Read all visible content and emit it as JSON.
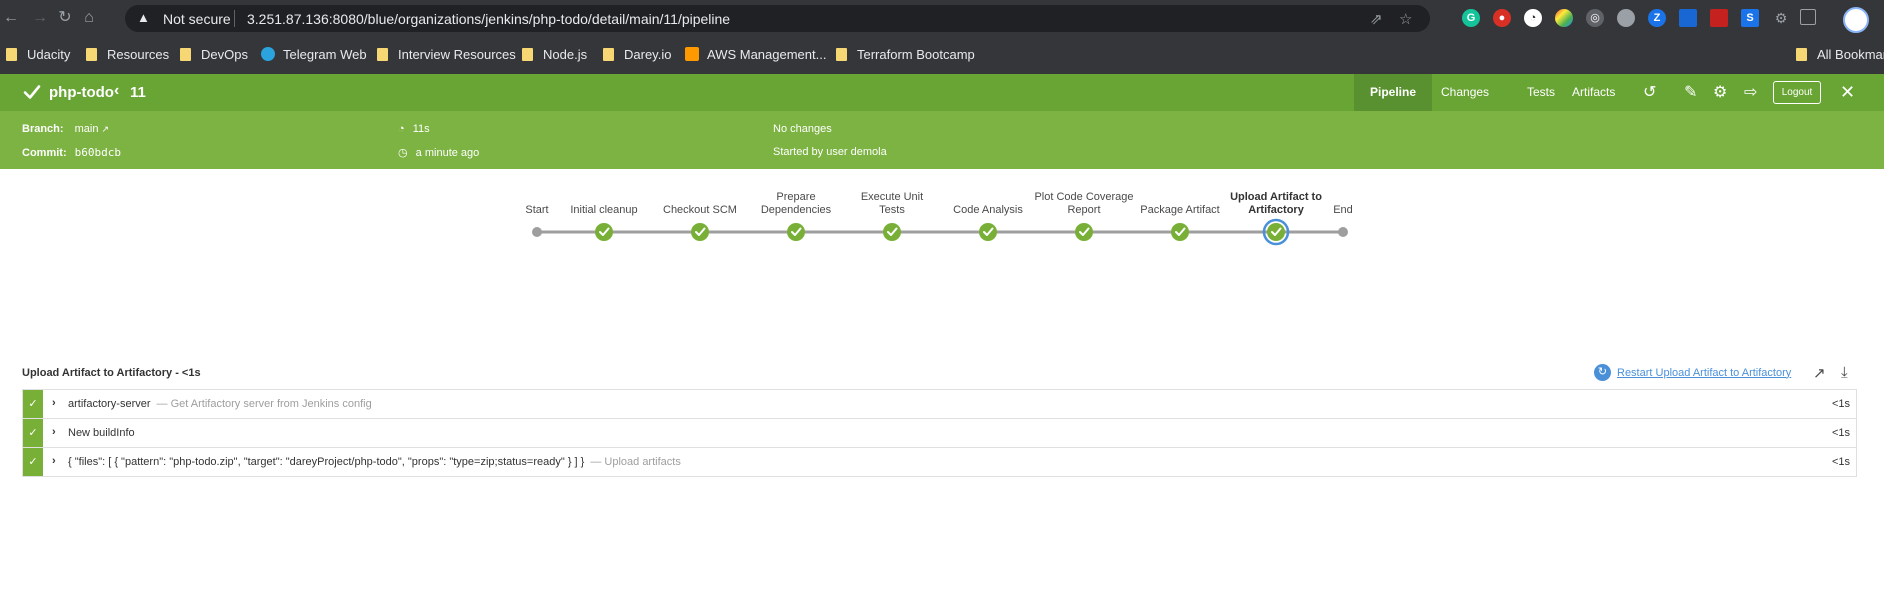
{
  "browser": {
    "security_label": "Not secure",
    "url": "3.251.87.136:8080/blue/organizations/jenkins/php-todo/detail/main/11/pipeline",
    "bookmarks": [
      {
        "label": "Udacity",
        "icon": "folder-icon"
      },
      {
        "label": "Resources",
        "icon": "folder-icon"
      },
      {
        "label": "DevOps",
        "icon": "folder-icon"
      },
      {
        "label": "Telegram Web",
        "icon": "telegram-icon"
      },
      {
        "label": "Interview Resources",
        "icon": "folder-icon"
      },
      {
        "label": "Node.js",
        "icon": "folder-icon"
      },
      {
        "label": "Darey.io",
        "icon": "folder-icon"
      },
      {
        "label": "AWS Management...",
        "icon": "aws-icon"
      },
      {
        "label": "Terraform Bootcamp",
        "icon": "folder-icon"
      }
    ],
    "all_bookmarks": "All Bookmar"
  },
  "header": {
    "project": "php-todo",
    "run_number": "11",
    "tabs": [
      "Pipeline",
      "Changes",
      "Tests",
      "Artifacts"
    ],
    "active_tab": "Pipeline",
    "logout_label": "Logout",
    "accent_color": "#69a535"
  },
  "meta": {
    "branch_label": "Branch:",
    "branch_value": "main",
    "commit_label": "Commit:",
    "commit_value": "b60bdcb",
    "duration": "11s",
    "time_ago": "a minute ago",
    "changes": "No changes",
    "started_by": "Started by user demola"
  },
  "pipeline": {
    "stages": [
      {
        "label": "Start",
        "status": "start"
      },
      {
        "label": "Initial cleanup",
        "status": "success"
      },
      {
        "label": "Checkout SCM",
        "status": "success"
      },
      {
        "label": "Prepare Dependencies",
        "status": "success"
      },
      {
        "label": "Execute Unit Tests",
        "status": "success"
      },
      {
        "label": "Code Analysis",
        "status": "success"
      },
      {
        "label": "Plot Code Coverage Report",
        "status": "success"
      },
      {
        "label": "Package Artifact",
        "status": "success"
      },
      {
        "label": "Upload Artifact to Artifactory",
        "status": "success",
        "selected": true
      },
      {
        "label": "End",
        "status": "end"
      }
    ]
  },
  "details": {
    "title": "Upload Artifact to Artifactory - <1s",
    "restart_label": "Restart Upload Artifact to Artifactory",
    "steps": [
      {
        "text": "artifactory-server",
        "desc": "— Get Artifactory server from Jenkins config",
        "duration": "<1s"
      },
      {
        "text": "New buildInfo",
        "desc": "",
        "duration": "<1s"
      },
      {
        "text": "{ \"files\": [ { \"pattern\": \"php-todo.zip\", \"target\": \"dareyProject/php-todo\", \"props\": \"type=zip;status=ready\" } ] }",
        "desc": "— Upload artifacts",
        "duration": "<1s"
      }
    ]
  }
}
